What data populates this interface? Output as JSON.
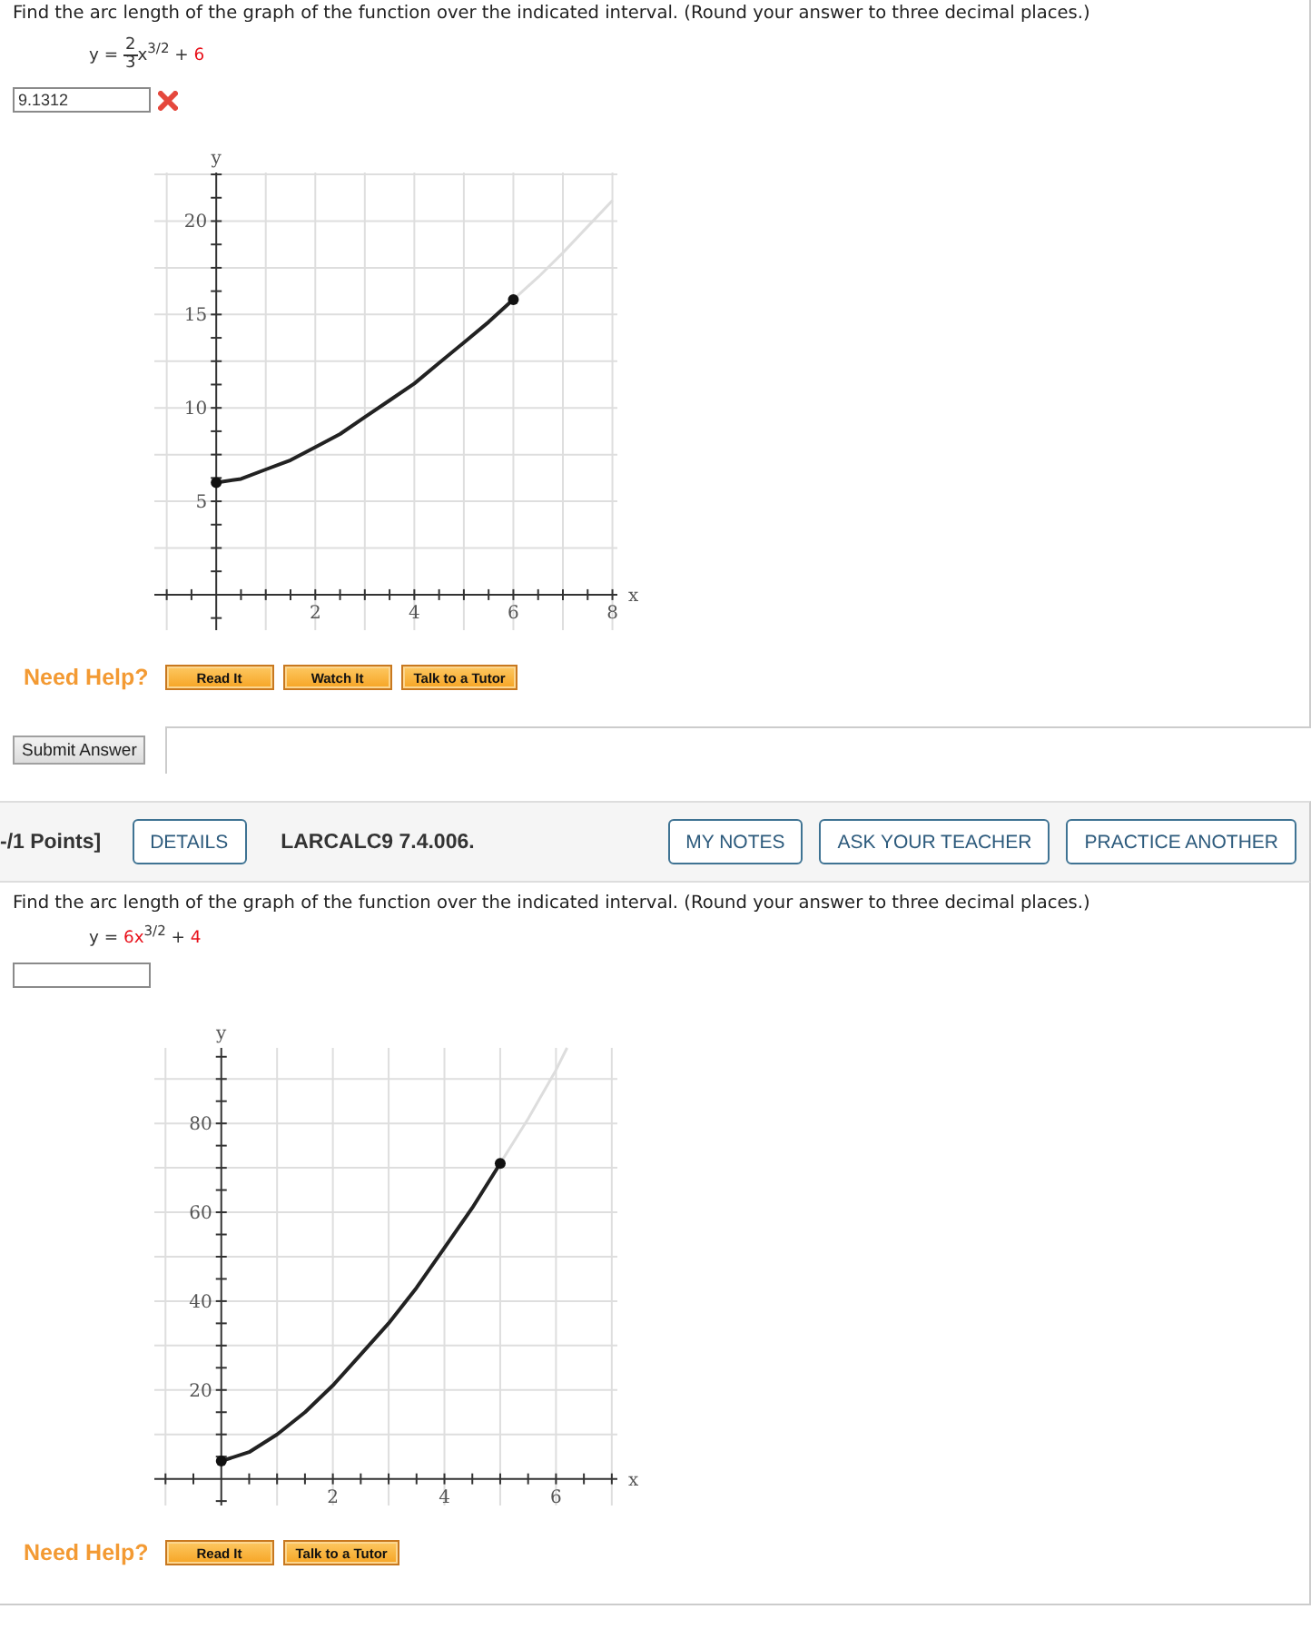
{
  "questions": [
    {
      "prompt": "Find the arc length of the graph of the function over the indicated interval. (Round your answer to three decimal places.)",
      "formula": [
        {
          "kind": "text",
          "text": "y = "
        },
        {
          "kind": "fraction",
          "numerator": "2",
          "denominator": "3"
        },
        {
          "kind": "text",
          "text": "x"
        },
        {
          "kind": "superscript",
          "text": "3/2"
        },
        {
          "kind": "text",
          "text": " + "
        },
        {
          "kind": "value",
          "text": "6"
        }
      ],
      "answer": {
        "value": "9.1312",
        "incorrect": true
      },
      "graph": {
        "chart_data": {
          "type": "line",
          "xlabel": "x",
          "ylabel": "y",
          "grid": true,
          "x": [
            0,
            0.5,
            1,
            1.5,
            2,
            2.5,
            3,
            3.5,
            4,
            4.5,
            5,
            5.5,
            6,
            6.5,
            7,
            7.5,
            8
          ],
          "series": [
            {
              "color": "#222222",
              "values": [
                6,
                6.2,
                6.7,
                7.2,
                7.9,
                8.6,
                9.5,
                10.4,
                11.3,
                12.4,
                13.5,
                14.6,
                15.8,
                null,
                null,
                null,
                null
              ]
            },
            {
              "color": "#dddddd",
              "values": [
                null,
                null,
                null,
                null,
                null,
                null,
                null,
                null,
                null,
                null,
                null,
                null,
                15.8,
                17,
                18.3,
                19.7,
                21.1
              ]
            }
          ],
          "xlim": [
            -1.25,
            8.1
          ],
          "ylim": [
            -1.9,
            22.6
          ],
          "xticks": [
            2,
            4,
            6,
            8
          ],
          "yticks": [
            5,
            10,
            15,
            20
          ]
        }
      },
      "help": {
        "label": "Need Help?",
        "buttons": [
          "Read It",
          "Watch It",
          "Talk to a Tutor"
        ]
      },
      "submit": "Submit Answer"
    },
    {
      "header": {
        "points": "-/1 Points]",
        "details": "DETAILS",
        "reference": "LARCALC9 7.4.006.",
        "actions": [
          "MY NOTES",
          "ASK YOUR TEACHER",
          "PRACTICE ANOTHER"
        ]
      },
      "prompt": "Find the arc length of the graph of the function over the indicated interval. (Round your answer to three decimal places.)",
      "formula": [
        {
          "kind": "text",
          "text": "y = "
        },
        {
          "kind": "value",
          "text": "6x"
        },
        {
          "kind": "superscript",
          "text": "3/2"
        },
        {
          "kind": "text",
          "text": " + "
        },
        {
          "kind": "value",
          "text": "4"
        }
      ],
      "answer": {
        "incorrect": false
      },
      "graph": {
        "chart_data": {
          "type": "line",
          "xlabel": "x",
          "ylabel": "y",
          "grid": true,
          "x": [
            0,
            0.5,
            1,
            1.5,
            2,
            2.5,
            3,
            3.5,
            4,
            4.5,
            5,
            5.5,
            6,
            6.2
          ],
          "series": [
            {
              "color": "#222222",
              "values": [
                4,
                6,
                10,
                15,
                21,
                28,
                35,
                43,
                52,
                61,
                71,
                null,
                null,
                null
              ]
            },
            {
              "color": "#dddddd",
              "values": [
                null,
                null,
                null,
                null,
                null,
                null,
                null,
                null,
                null,
                null,
                71,
                81,
                92,
                97
              ]
            }
          ],
          "xlim": [
            -1.2,
            7.1
          ],
          "ylim": [
            -6,
            97
          ],
          "xticks": [
            2,
            4,
            6
          ],
          "yticks": [
            20,
            40,
            60,
            80
          ]
        }
      },
      "help": {
        "label": "Need Help?",
        "buttons": [
          "Read It",
          "Talk to a Tutor"
        ]
      }
    }
  ]
}
